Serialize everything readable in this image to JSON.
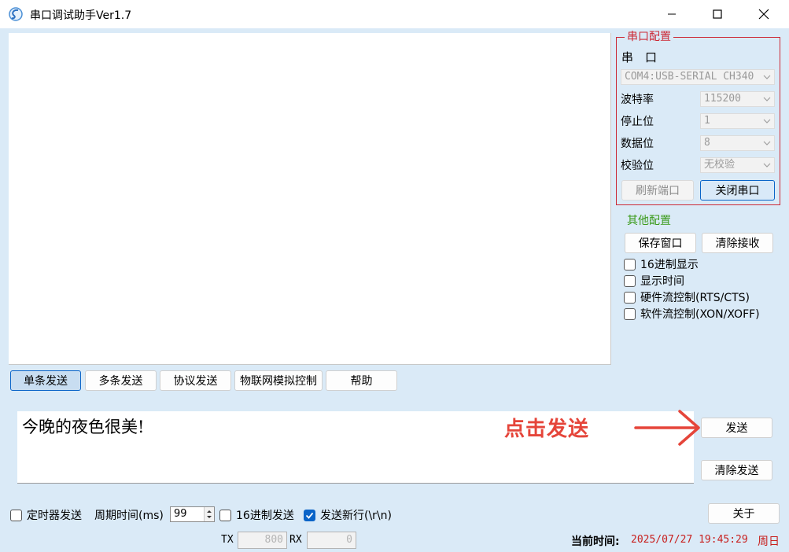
{
  "window": {
    "title": "串口调试助手Ver1.7"
  },
  "serial_config": {
    "legend": "串口配置",
    "port_label": "串　口",
    "port_value": "COM4:USB-SERIAL CH340",
    "baud_label": "波特率",
    "baud_value": "115200",
    "stop_label": "停止位",
    "stop_value": "1",
    "data_label": "数据位",
    "data_value": "8",
    "parity_label": "校验位",
    "parity_value": "无校验",
    "refresh_button": "刷新端口",
    "close_button": "关闭串口"
  },
  "other_config": {
    "legend": "其他配置",
    "save_button": "保存窗口",
    "clear_receive_button": "清除接收",
    "options": [
      {
        "label": "16进制显示",
        "checked": false
      },
      {
        "label": "显示时间",
        "checked": false
      },
      {
        "label": "硬件流控制(RTS/CTS)",
        "checked": false
      },
      {
        "label": "软件流控制(XON/XOFF)",
        "checked": false
      }
    ]
  },
  "tabs": [
    {
      "label": "单条发送",
      "active": true
    },
    {
      "label": "多条发送",
      "active": false
    },
    {
      "label": "协议发送",
      "active": false
    },
    {
      "label": "物联网模拟控制",
      "active": false
    },
    {
      "label": "帮助",
      "active": false
    }
  ],
  "send": {
    "text": "今晚的夜色很美!",
    "annotation": "点击发送",
    "send_button": "发送",
    "clear_button": "清除发送"
  },
  "bottom": {
    "timer_send": {
      "label": "定时器发送",
      "checked": false
    },
    "period_label": "周期时间(ms)",
    "period_value": "99",
    "hex_send": {
      "label": "16进制发送",
      "checked": false
    },
    "newline": {
      "label": "发送新行(\\r\\n)",
      "checked": true
    },
    "about_button": "关于"
  },
  "status": {
    "tx_label": "TX",
    "tx_value": "800",
    "rx_label": "RX",
    "rx_value": "0",
    "time_label": "当前时间:",
    "time_value": "2025/07/27 19:45:29",
    "weekday": "周日"
  },
  "colors": {
    "serial_group_border": "#cc2936",
    "other_legend": "#3a9a1a",
    "annotation": "#e5453a",
    "time_text": "#c8201e",
    "accent": "#0a64c8",
    "panel_bg": "#daeaf7"
  }
}
